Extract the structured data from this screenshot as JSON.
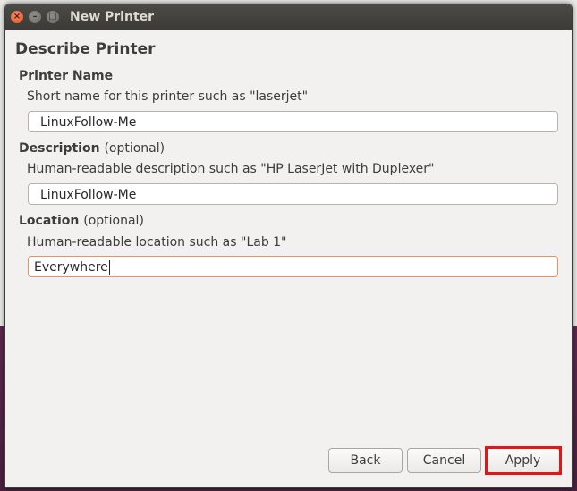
{
  "window": {
    "title": "New Printer"
  },
  "page": {
    "heading": "Describe Printer"
  },
  "printer_name": {
    "label": "Printer Name",
    "hint": "Short name for this printer such as \"laserjet\"",
    "value": "LinuxFollow-Me"
  },
  "description": {
    "label": "Description",
    "optional": "(optional)",
    "hint": "Human-readable description such as \"HP LaserJet with Duplexer\"",
    "value": "LinuxFollow-Me"
  },
  "location": {
    "label": "Location",
    "optional": "(optional)",
    "hint": "Human-readable location such as \"Lab 1\"",
    "value": "Everywhere"
  },
  "buttons": {
    "back": "Back",
    "cancel": "Cancel",
    "apply": "Apply"
  },
  "colors": {
    "highlight": "#e21616",
    "focus_border": "#e8935f",
    "titlebar": "#3c3b37"
  }
}
